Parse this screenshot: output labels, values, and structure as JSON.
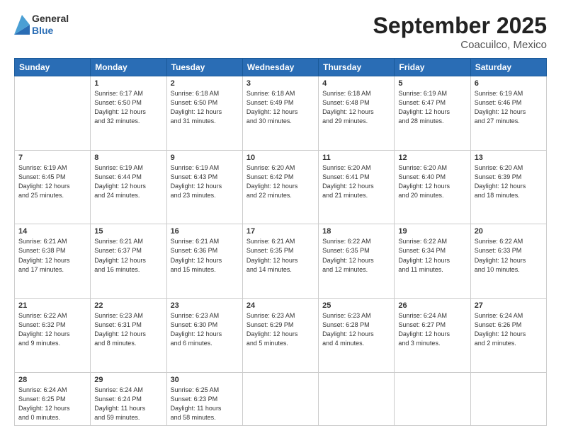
{
  "header": {
    "logo": {
      "general": "General",
      "blue": "Blue"
    },
    "title": "September 2025",
    "subtitle": "Coacuilco, Mexico"
  },
  "days_of_week": [
    "Sunday",
    "Monday",
    "Tuesday",
    "Wednesday",
    "Thursday",
    "Friday",
    "Saturday"
  ],
  "weeks": [
    [
      {
        "day": "",
        "info": ""
      },
      {
        "day": "1",
        "info": "Sunrise: 6:17 AM\nSunset: 6:50 PM\nDaylight: 12 hours\nand 32 minutes."
      },
      {
        "day": "2",
        "info": "Sunrise: 6:18 AM\nSunset: 6:50 PM\nDaylight: 12 hours\nand 31 minutes."
      },
      {
        "day": "3",
        "info": "Sunrise: 6:18 AM\nSunset: 6:49 PM\nDaylight: 12 hours\nand 30 minutes."
      },
      {
        "day": "4",
        "info": "Sunrise: 6:18 AM\nSunset: 6:48 PM\nDaylight: 12 hours\nand 29 minutes."
      },
      {
        "day": "5",
        "info": "Sunrise: 6:19 AM\nSunset: 6:47 PM\nDaylight: 12 hours\nand 28 minutes."
      },
      {
        "day": "6",
        "info": "Sunrise: 6:19 AM\nSunset: 6:46 PM\nDaylight: 12 hours\nand 27 minutes."
      }
    ],
    [
      {
        "day": "7",
        "info": "Sunrise: 6:19 AM\nSunset: 6:45 PM\nDaylight: 12 hours\nand 25 minutes."
      },
      {
        "day": "8",
        "info": "Sunrise: 6:19 AM\nSunset: 6:44 PM\nDaylight: 12 hours\nand 24 minutes."
      },
      {
        "day": "9",
        "info": "Sunrise: 6:19 AM\nSunset: 6:43 PM\nDaylight: 12 hours\nand 23 minutes."
      },
      {
        "day": "10",
        "info": "Sunrise: 6:20 AM\nSunset: 6:42 PM\nDaylight: 12 hours\nand 22 minutes."
      },
      {
        "day": "11",
        "info": "Sunrise: 6:20 AM\nSunset: 6:41 PM\nDaylight: 12 hours\nand 21 minutes."
      },
      {
        "day": "12",
        "info": "Sunrise: 6:20 AM\nSunset: 6:40 PM\nDaylight: 12 hours\nand 20 minutes."
      },
      {
        "day": "13",
        "info": "Sunrise: 6:20 AM\nSunset: 6:39 PM\nDaylight: 12 hours\nand 18 minutes."
      }
    ],
    [
      {
        "day": "14",
        "info": "Sunrise: 6:21 AM\nSunset: 6:38 PM\nDaylight: 12 hours\nand 17 minutes."
      },
      {
        "day": "15",
        "info": "Sunrise: 6:21 AM\nSunset: 6:37 PM\nDaylight: 12 hours\nand 16 minutes."
      },
      {
        "day": "16",
        "info": "Sunrise: 6:21 AM\nSunset: 6:36 PM\nDaylight: 12 hours\nand 15 minutes."
      },
      {
        "day": "17",
        "info": "Sunrise: 6:21 AM\nSunset: 6:35 PM\nDaylight: 12 hours\nand 14 minutes."
      },
      {
        "day": "18",
        "info": "Sunrise: 6:22 AM\nSunset: 6:35 PM\nDaylight: 12 hours\nand 12 minutes."
      },
      {
        "day": "19",
        "info": "Sunrise: 6:22 AM\nSunset: 6:34 PM\nDaylight: 12 hours\nand 11 minutes."
      },
      {
        "day": "20",
        "info": "Sunrise: 6:22 AM\nSunset: 6:33 PM\nDaylight: 12 hours\nand 10 minutes."
      }
    ],
    [
      {
        "day": "21",
        "info": "Sunrise: 6:22 AM\nSunset: 6:32 PM\nDaylight: 12 hours\nand 9 minutes."
      },
      {
        "day": "22",
        "info": "Sunrise: 6:23 AM\nSunset: 6:31 PM\nDaylight: 12 hours\nand 8 minutes."
      },
      {
        "day": "23",
        "info": "Sunrise: 6:23 AM\nSunset: 6:30 PM\nDaylight: 12 hours\nand 6 minutes."
      },
      {
        "day": "24",
        "info": "Sunrise: 6:23 AM\nSunset: 6:29 PM\nDaylight: 12 hours\nand 5 minutes."
      },
      {
        "day": "25",
        "info": "Sunrise: 6:23 AM\nSunset: 6:28 PM\nDaylight: 12 hours\nand 4 minutes."
      },
      {
        "day": "26",
        "info": "Sunrise: 6:24 AM\nSunset: 6:27 PM\nDaylight: 12 hours\nand 3 minutes."
      },
      {
        "day": "27",
        "info": "Sunrise: 6:24 AM\nSunset: 6:26 PM\nDaylight: 12 hours\nand 2 minutes."
      }
    ],
    [
      {
        "day": "28",
        "info": "Sunrise: 6:24 AM\nSunset: 6:25 PM\nDaylight: 12 hours\nand 0 minutes."
      },
      {
        "day": "29",
        "info": "Sunrise: 6:24 AM\nSunset: 6:24 PM\nDaylight: 11 hours\nand 59 minutes."
      },
      {
        "day": "30",
        "info": "Sunrise: 6:25 AM\nSunset: 6:23 PM\nDaylight: 11 hours\nand 58 minutes."
      },
      {
        "day": "",
        "info": ""
      },
      {
        "day": "",
        "info": ""
      },
      {
        "day": "",
        "info": ""
      },
      {
        "day": "",
        "info": ""
      }
    ]
  ]
}
